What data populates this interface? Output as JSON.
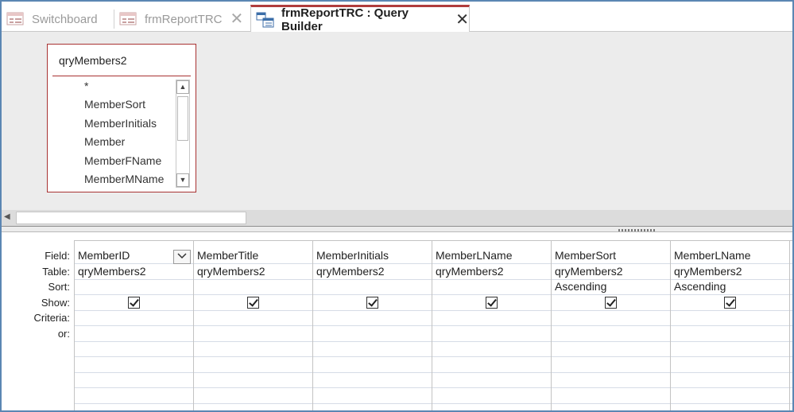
{
  "tabs": [
    {
      "label": "Switchboard",
      "icon": "form-icon",
      "active": false
    },
    {
      "label": "frmReportTRC",
      "icon": "form-icon",
      "active": false
    },
    {
      "label": "frmReportTRC : Query Builder",
      "icon": "query-icon",
      "active": true
    }
  ],
  "close_glyph": "✕",
  "table_box": {
    "title": "qryMembers2",
    "fields": [
      "*",
      "MemberSort",
      "MemberInitials",
      "Member",
      "MemberFName",
      "MemberMName"
    ]
  },
  "grid": {
    "row_labels": [
      "Field:",
      "Table:",
      "Sort:",
      "Show:",
      "Criteria:",
      "or:"
    ],
    "columns": [
      {
        "field": "MemberID",
        "table": "qryMembers2",
        "sort": "",
        "show": true
      },
      {
        "field": "MemberTitle",
        "table": "qryMembers2",
        "sort": "",
        "show": true
      },
      {
        "field": "MemberInitials",
        "table": "qryMembers2",
        "sort": "",
        "show": true
      },
      {
        "field": "MemberLName",
        "table": "qryMembers2",
        "sort": "",
        "show": true
      },
      {
        "field": "MemberSort",
        "table": "qryMembers2",
        "sort": "Ascending",
        "show": true
      },
      {
        "field": "MemberLName",
        "table": "qryMembers2",
        "sort": "Ascending",
        "show": true
      }
    ]
  },
  "colors": {
    "accent": "#b03c3c",
    "frame": "#5b86b3",
    "pane": "#ececec"
  }
}
